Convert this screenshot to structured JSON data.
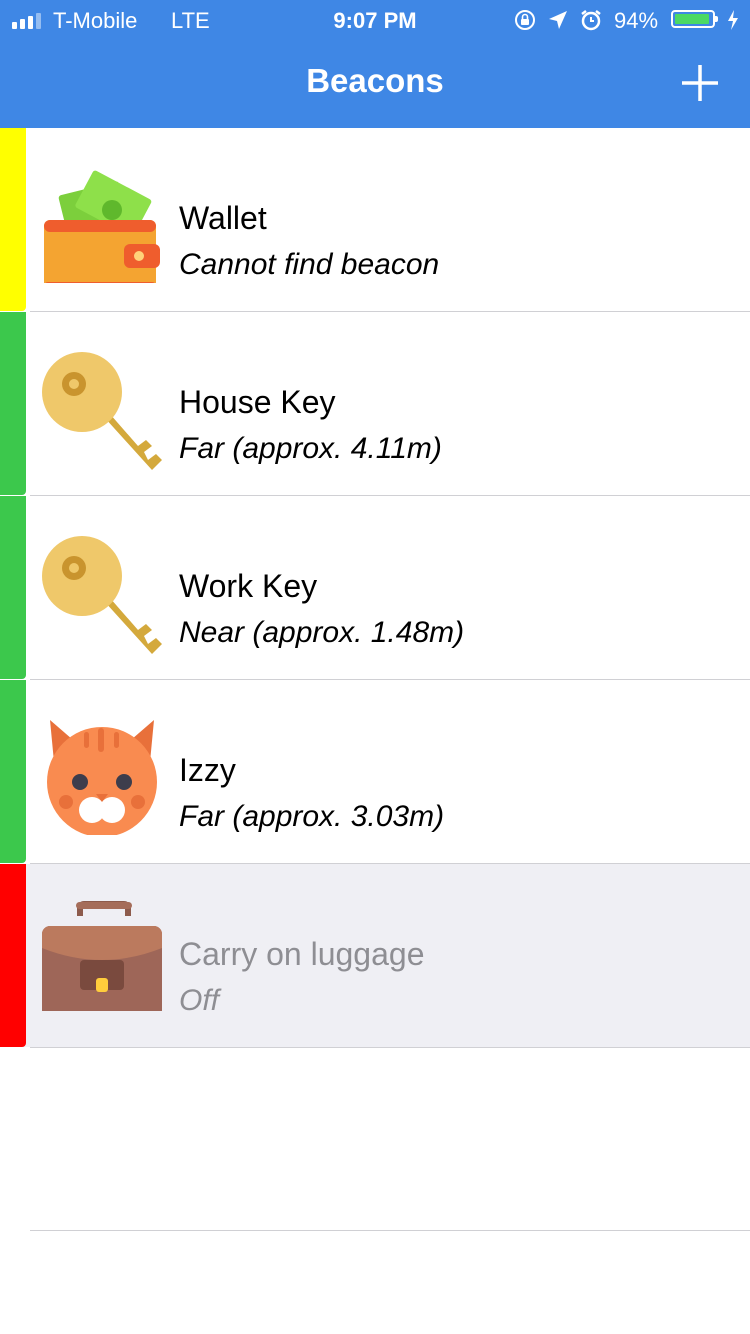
{
  "status_bar": {
    "carrier": "T-Mobile",
    "network": "LTE",
    "time": "9:07 PM",
    "battery_percent": "94%",
    "signal_bars": 3,
    "icons": [
      "orientation-lock-icon",
      "location-arrow-icon",
      "alarm-icon"
    ]
  },
  "nav": {
    "title": "Beacons",
    "add_icon": "plus-icon"
  },
  "colors": {
    "nav_blue": "#3f87e5",
    "status_yellow": "#ffff00",
    "status_green": "#3cc84c",
    "status_red": "#ff0000",
    "off_row_bg": "#efeff4"
  },
  "beacons": [
    {
      "name": "Wallet",
      "status": "Cannot find beacon",
      "icon": "wallet-icon",
      "indicator": "yellow"
    },
    {
      "name": "House Key",
      "status": "Far (approx. 4.11m)",
      "icon": "key-icon",
      "indicator": "green"
    },
    {
      "name": "Work Key",
      "status": "Near (approx. 1.48m)",
      "icon": "key-icon",
      "indicator": "green"
    },
    {
      "name": "Izzy",
      "status": "Far (approx. 3.03m)",
      "icon": "cat-icon",
      "indicator": "green"
    },
    {
      "name": "Carry on luggage",
      "status": "Off",
      "icon": "briefcase-icon",
      "indicator": "red"
    }
  ]
}
